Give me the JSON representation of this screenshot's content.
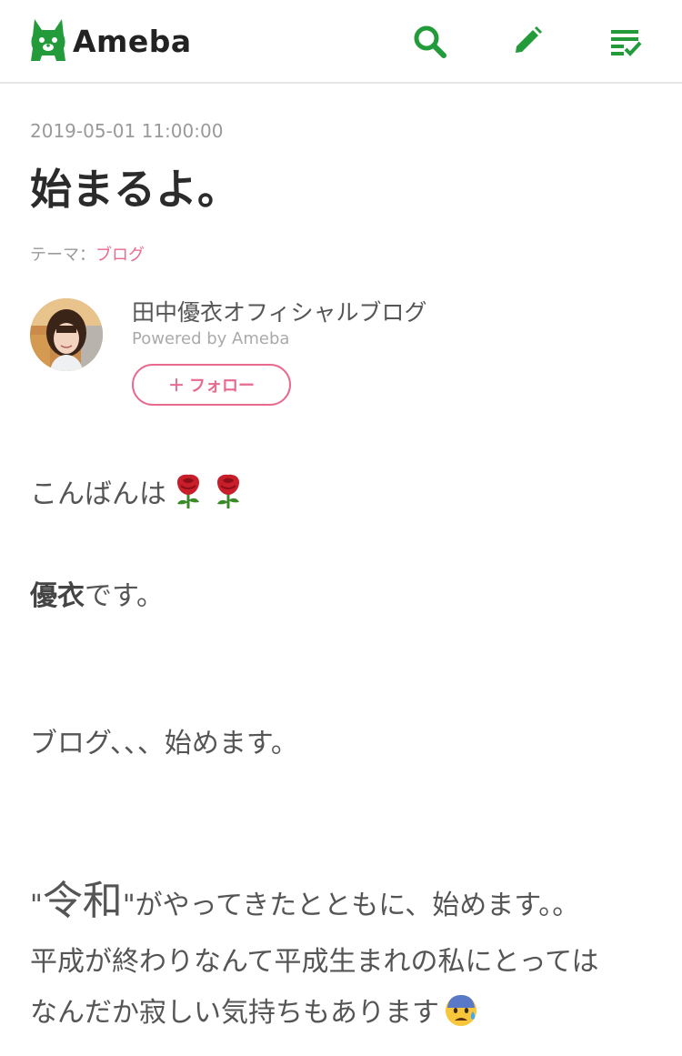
{
  "header": {
    "logo_text": "Ameba",
    "icons": {
      "search": "search-icon",
      "edit": "pencil-icon",
      "menu": "checklist-icon"
    },
    "brand_color": "#239b3a"
  },
  "article": {
    "date": "2019-05-01 11:00:00",
    "title": "始まるよ。",
    "theme_label": "テーマ：",
    "theme_value": "ブログ",
    "author": {
      "blog_name": "田中優衣オフィシャルブログ",
      "powered_by": "Powered by Ameba",
      "follow_label": "＋ フォロー"
    },
    "body": {
      "p1": "こんばんは",
      "p1_emojis": [
        "rose-emoji",
        "rose-emoji"
      ],
      "p2_bold": "優衣",
      "p2_rest": "です。",
      "p3": "ブログ、、、始めます。",
      "p4_quote_open": "\"",
      "p4_big": "令和",
      "p4_rest": "\"がやってきたとともに、始めます。。",
      "p5": "平成が終わりなんて平成生まれの私にとっては",
      "p6": "なんだか寂しい気持ちもあります",
      "p6_emoji": "anxious-face-emoji"
    },
    "accent_color": "#e86a8f"
  }
}
